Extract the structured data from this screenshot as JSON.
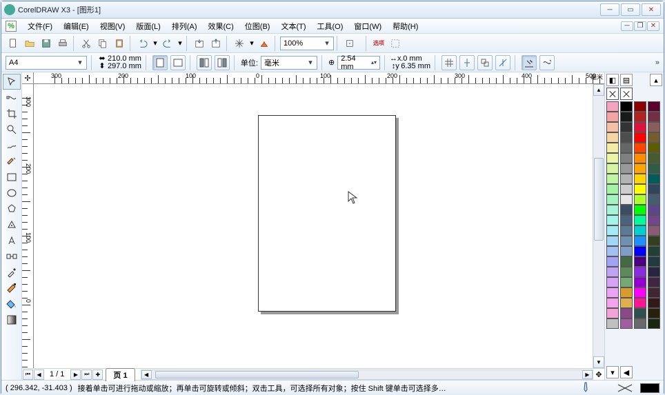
{
  "title": "CorelDRAW X3 - [图形1]",
  "menu": [
    "文件(F)",
    "编辑(E)",
    "视图(V)",
    "版面(L)",
    "排列(A)",
    "效果(C)",
    "位图(B)",
    "文本(T)",
    "工具(O)",
    "窗口(W)",
    "帮助(H)"
  ],
  "toolbar": {
    "zoom": "100%"
  },
  "propbar": {
    "paper": "A4",
    "width": "210.0 mm",
    "height": "297.0 mm",
    "units_label": "单位:",
    "units": "毫米",
    "nudge": "2.54 mm",
    "dup_x": ".0 mm",
    "dup_y": "6.35 mm"
  },
  "ruler_units": "毫米",
  "hruler_labels": [
    "300",
    "200",
    "100",
    "0",
    "100",
    "200",
    "300",
    "400",
    "500"
  ],
  "vruler_labels": [
    "300",
    "200",
    "100",
    "0"
  ],
  "pagebar": {
    "count": "1 / 1",
    "tab": "页 1"
  },
  "status": {
    "coords": "( 296.342, -31.403 )",
    "hint": "接着单击可进行拖动或缩放；再单击可旋转或倾斜；双击工具，可选择所有对象；按住 Shift 键单击可选择多…"
  },
  "palette_cols": [
    [
      "#f5a3c0",
      "#f5a3a3",
      "#f5c0a3",
      "#f5d6a3",
      "#f5eca3",
      "#ecf5a3",
      "#d6f5a3",
      "#c0f5a3",
      "#a3f5a3",
      "#a3f5c0",
      "#a3f5d6",
      "#a3f5ec",
      "#a3ecf5",
      "#a3d6f5",
      "#a3c0f5",
      "#a3a3f5",
      "#c0a3f5",
      "#d6a3f5",
      "#eca3f5",
      "#f5a3ec",
      "#f5a3d6",
      "#c0c0c0"
    ],
    [
      "#000000",
      "#1a1a1a",
      "#333333",
      "#4d4d4d",
      "#666666",
      "#808080",
      "#999999",
      "#b3b3b3",
      "#cccccc",
      "#e6e6e6",
      "#394d63",
      "#4a637d",
      "#5c7a97",
      "#6e91b1",
      "#809ec5",
      "#426b42",
      "#5c8a5c",
      "#76a876",
      "#d99a2e",
      "#e0b050",
      "#8a4a8a",
      "#a060a0"
    ],
    [
      "#8b0000",
      "#b22222",
      "#dc143c",
      "#ff0000",
      "#ff4500",
      "#ff8c00",
      "#ffa500",
      "#ffd700",
      "#ffff00",
      "#adff2f",
      "#00ff00",
      "#00fa9a",
      "#00ced1",
      "#1e90ff",
      "#0000ff",
      "#4b0082",
      "#8a2be2",
      "#9400d3",
      "#ff00ff",
      "#ff1493",
      "#2f4f4f",
      "#696969"
    ],
    [
      "#5c002e",
      "#732e45",
      "#8a5c5c",
      "#735c2e",
      "#5c5c00",
      "#455c2e",
      "#2e5c45",
      "#005c5c",
      "#2e455c",
      "#455c73",
      "#5c458a",
      "#73458a",
      "#8a5c73",
      "#334020",
      "#204033",
      "#203a40",
      "#262640",
      "#402640",
      "#402633",
      "#331a1a",
      "#26200d",
      "#1a260d"
    ]
  ]
}
